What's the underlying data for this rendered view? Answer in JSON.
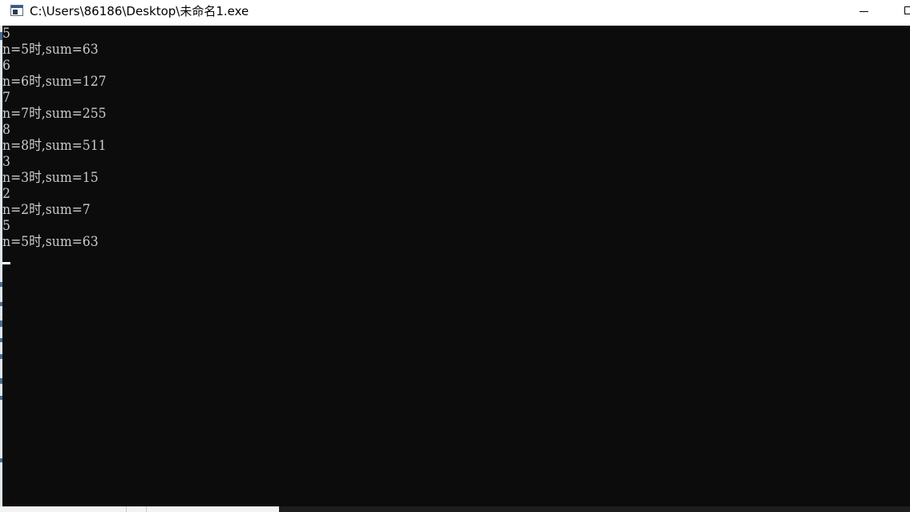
{
  "window": {
    "title": "C:\\Users\\86186\\Desktop\\未命名1.exe",
    "icon": "console-app-icon",
    "controls": {
      "minimize": "minimize-icon",
      "maximize": "maximize-icon"
    }
  },
  "console": {
    "background": "#0c0c0c",
    "foreground": "#cccccc",
    "lines": [
      "5",
      "n=5时,sum=63",
      "6",
      "n=6时,sum=127",
      "7",
      "n=7时,sum=255",
      "8",
      "n=8时,sum=511",
      "3",
      "n=3时,sum=15",
      "2",
      "n=2时,sum=7",
      "5",
      "n=5时,sum=63"
    ]
  }
}
